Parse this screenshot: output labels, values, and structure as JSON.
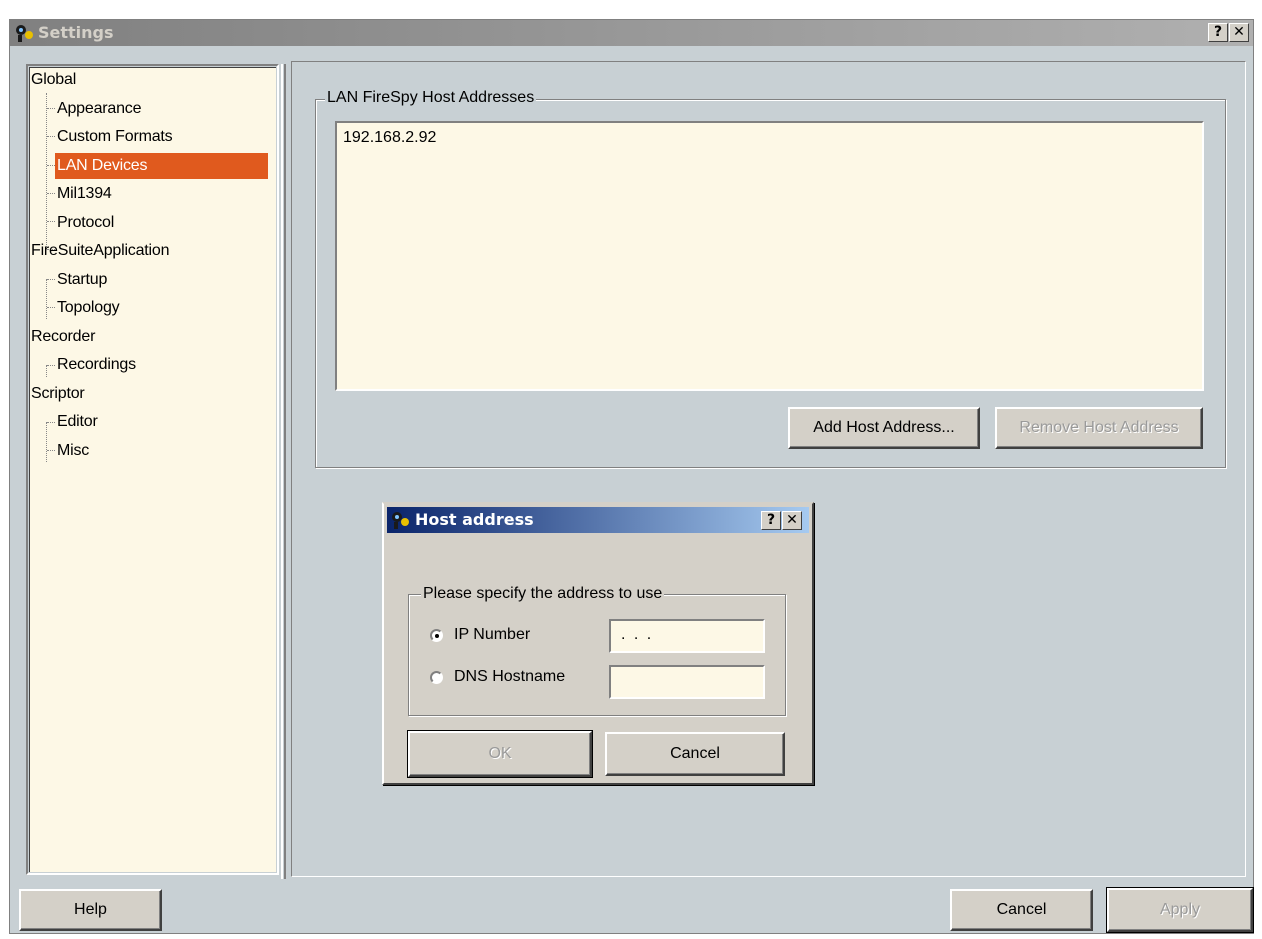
{
  "window": {
    "title": "Settings",
    "help_button": "?",
    "close_button": "✕"
  },
  "tree": {
    "items": [
      {
        "label": "Global",
        "level": 0
      },
      {
        "label": "Appearance",
        "level": 1
      },
      {
        "label": "Custom Formats",
        "level": 1
      },
      {
        "label": "LAN Devices",
        "level": 1,
        "selected": true
      },
      {
        "label": "Mil1394",
        "level": 1
      },
      {
        "label": "Protocol",
        "level": 1
      },
      {
        "label": "FireSuiteApplication",
        "level": 0
      },
      {
        "label": "Startup",
        "level": 1
      },
      {
        "label": "Topology",
        "level": 1
      },
      {
        "label": "Recorder",
        "level": 0
      },
      {
        "label": "Recordings",
        "level": 1
      },
      {
        "label": "Scriptor",
        "level": 0
      },
      {
        "label": "Editor",
        "level": 1
      },
      {
        "label": "Misc",
        "level": 1
      }
    ]
  },
  "lan": {
    "group_label": "LAN FireSpy Host Addresses",
    "hosts": [
      "192.168.2.92"
    ],
    "add_button": "Add Host Address...",
    "remove_button": "Remove Host Address"
  },
  "dialog": {
    "title": "Host address",
    "help_button": "?",
    "close_button": "✕",
    "group_label": "Please specify the address to use",
    "ip_label": "IP Number",
    "ip_value": ". . .",
    "dns_label": "DNS Hostname",
    "dns_value": "",
    "selected_option": "IP Number",
    "ok_button": "OK",
    "cancel_button": "Cancel"
  },
  "footer": {
    "help_button": "Help",
    "cancel_button": "Cancel",
    "apply_button": "Apply"
  }
}
